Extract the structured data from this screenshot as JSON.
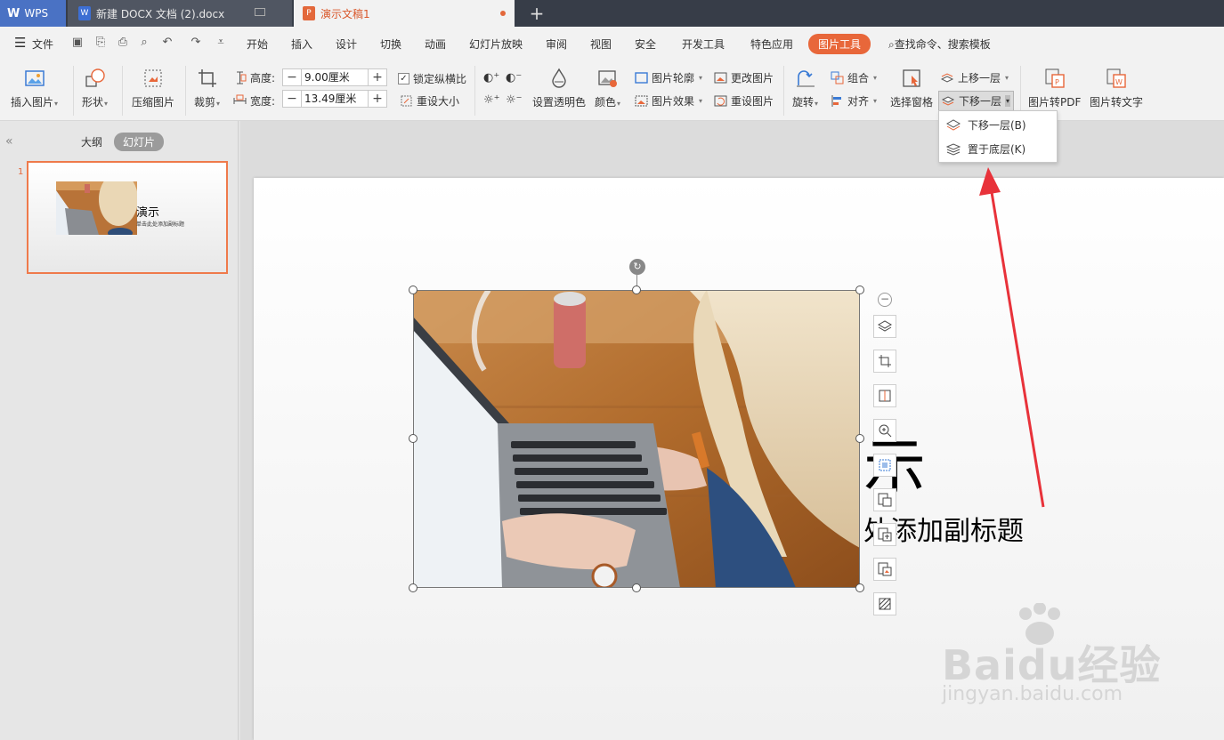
{
  "titlebar": {
    "wps_label": "WPS",
    "doc_tab": "新建 DOCX 文档 (2).docx",
    "ppt_tab": "演示文稿1",
    "new_tab": "+"
  },
  "menubar": {
    "file": "文件",
    "items": [
      "开始",
      "插入",
      "设计",
      "切换",
      "动画",
      "幻灯片放映",
      "审阅",
      "视图",
      "安全",
      "开发工具",
      "特色应用"
    ],
    "active": "图片工具",
    "search": "查找命令、搜索模板"
  },
  "ribbon": {
    "insert_image": "插入图片",
    "shape": "形状",
    "compress": "压缩图片",
    "crop": "裁剪",
    "height_label": "高度:",
    "height_value": "9.00厘米",
    "width_label": "宽度:",
    "width_value": "13.49厘米",
    "lock_ratio": "锁定纵横比",
    "reset_size": "重设大小",
    "set_transparent": "设置透明色",
    "color": "颜色",
    "outline": "图片轮廓",
    "effects": "图片效果",
    "change_image": "更改图片",
    "reset_image": "重设图片",
    "rotate": "旋转",
    "group": "组合",
    "align": "对齐",
    "selection_pane": "选择窗格",
    "bring_forward": "上移一层",
    "send_backward": "下移一层",
    "to_pdf": "图片转PDF",
    "to_text": "图片转文字"
  },
  "dropdown": {
    "items": [
      "下移一层(B)",
      "置于底层(K)"
    ]
  },
  "leftpanel": {
    "outline_tab": "大纲",
    "slides_tab": "幻灯片",
    "slide_number": "1",
    "thumb_title": "演示",
    "thumb_subtitle": "单击此处添加副标题"
  },
  "slide": {
    "title_visible": "演示",
    "subtitle_visible": "单击此处添加副标题"
  },
  "watermark": {
    "logo": "Baidu经验",
    "url": "jingyan.baidu.com"
  },
  "colors": {
    "accent": "#e8673a",
    "titlebar": "#373d48",
    "wps_blue": "#4a72c4",
    "arrow_red": "#e8323a"
  }
}
